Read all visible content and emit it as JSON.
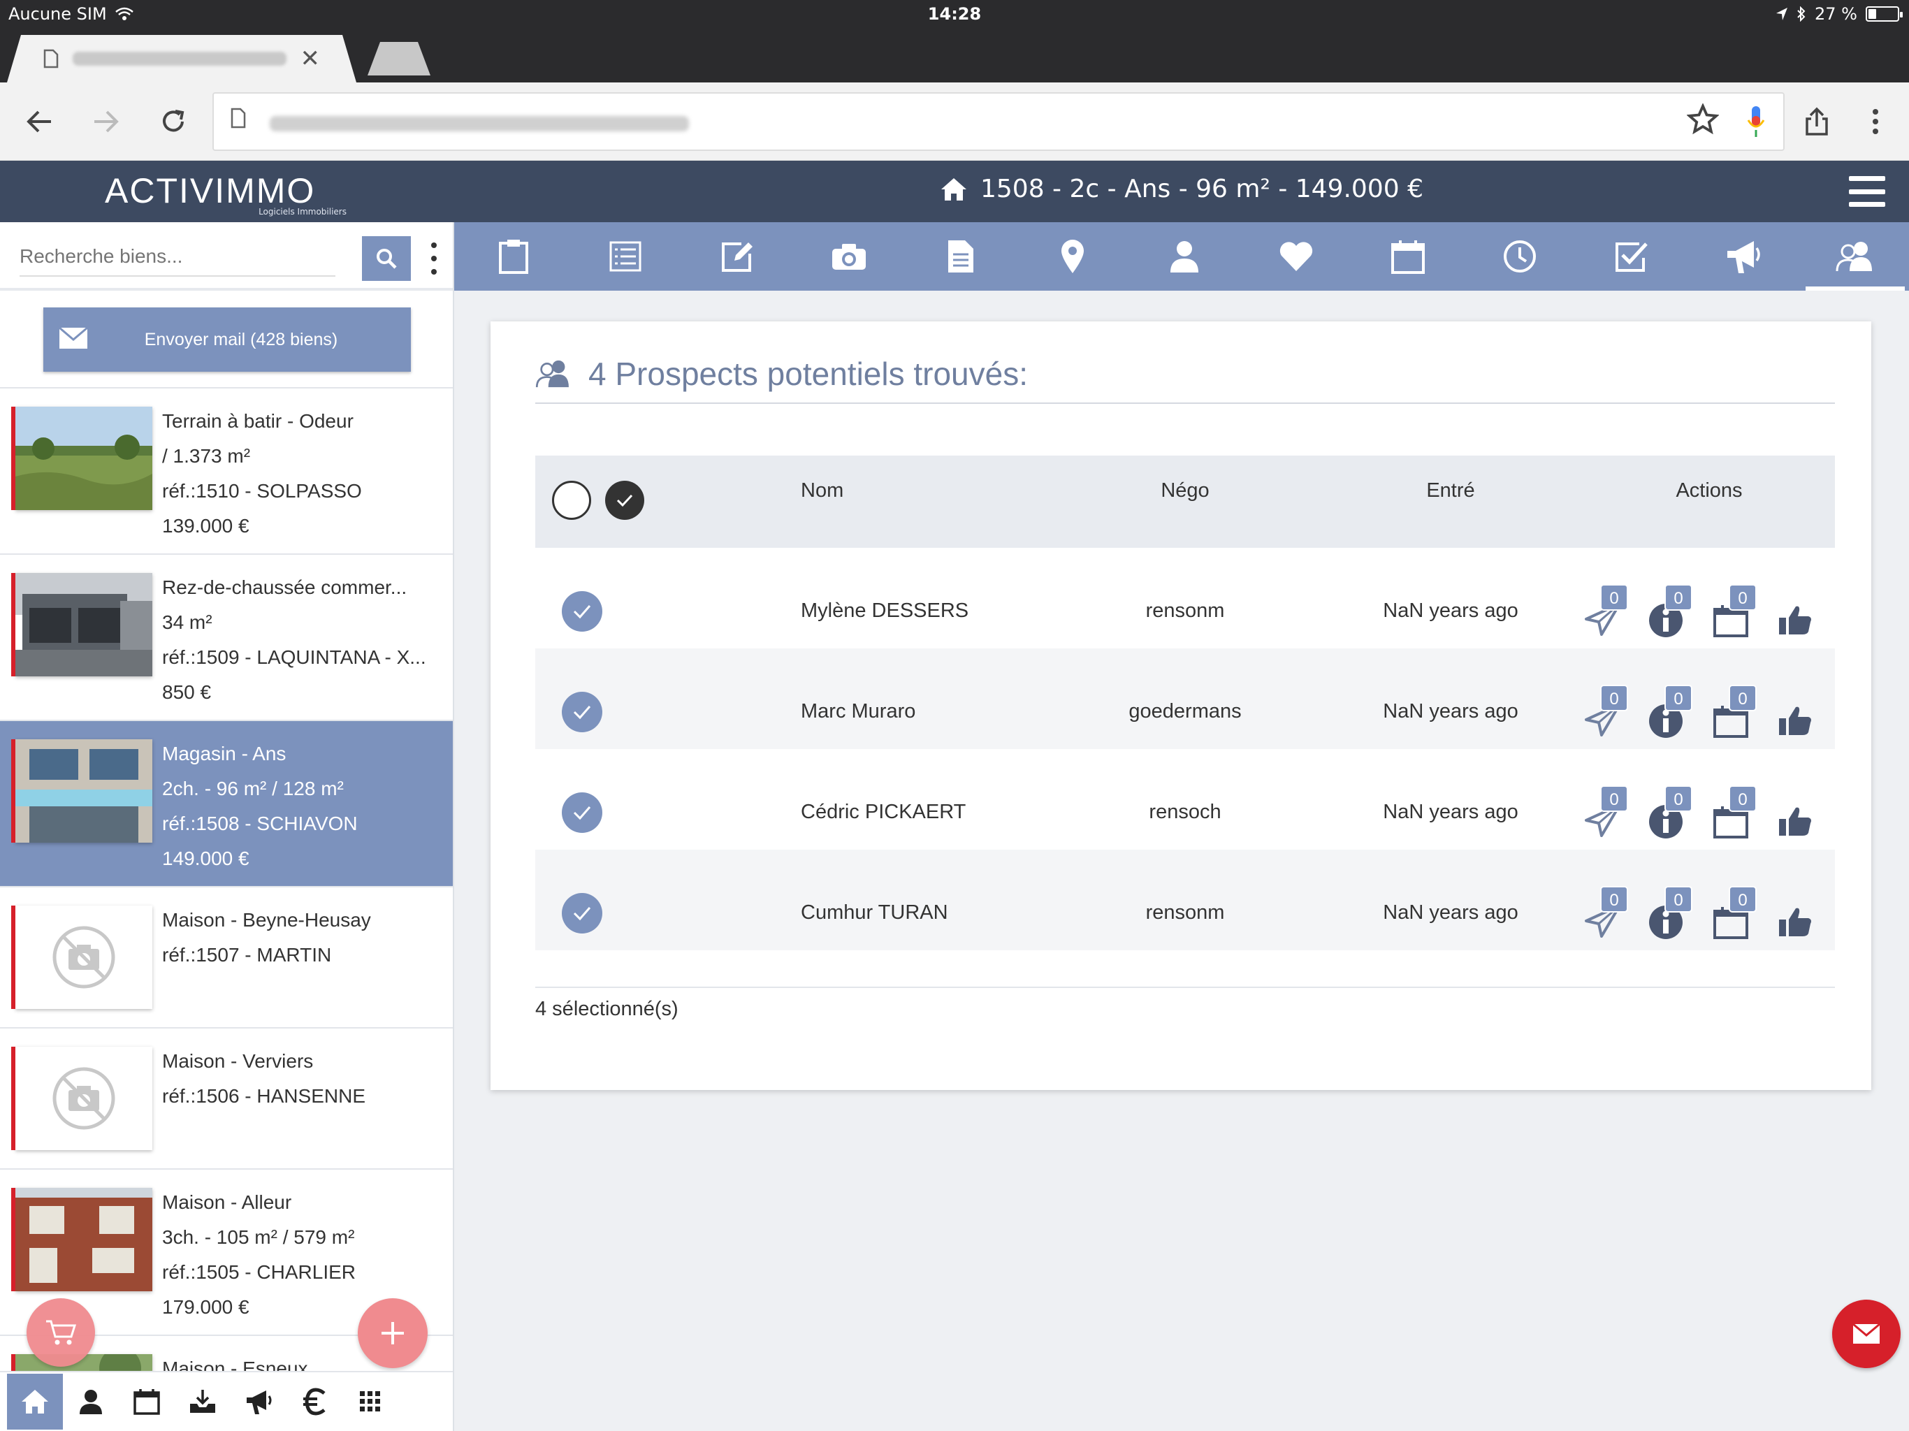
{
  "status_bar": {
    "carrier": "Aucune SIM",
    "time": "14:28",
    "battery_percent": "27 %",
    "battery_level": 0.27
  },
  "browser": {
    "icons": {
      "back": "arrow-left-icon",
      "forward": "arrow-right-icon",
      "reload": "reload-icon",
      "bookmark": "star-icon",
      "voice": "mic-icon",
      "share": "share-icon",
      "menu": "more-vertical-icon",
      "tab_close": "close-icon"
    }
  },
  "header": {
    "logo_text": "ACTIVIMMO",
    "logo_tagline": "Logiciels Immobiliers",
    "title": "1508 - 2c - Ans - 96 m² - 149.000 €"
  },
  "sidebar": {
    "search_placeholder": "Recherche biens...",
    "mail_button_label": "Envoyer mail (428 biens)",
    "properties": [
      {
        "lines": [
          "Terrain à batir - Odeur",
          "/ 1.373 m²",
          "réf.:1510 - SOLPASSO",
          "139.000 €"
        ],
        "image": "field",
        "selected": false
      },
      {
        "lines": [
          "Rez-de-chaussée commer...",
          "34 m²",
          "réf.:1509 - LAQUINTANA - X...",
          "850 €"
        ],
        "image": "storefront",
        "selected": false
      },
      {
        "lines": [
          "Magasin - Ans",
          "2ch. - 96 m² / 128 m²",
          "réf.:1508 - SCHIAVON",
          "149.000 €"
        ],
        "image": "shop",
        "selected": true
      },
      {
        "lines": [
          "Maison - Beyne-Heusay",
          "réf.:1507 - MARTIN"
        ],
        "image": "none",
        "selected": false
      },
      {
        "lines": [
          "Maison - Verviers",
          "réf.:1506 - HANSENNE"
        ],
        "image": "none",
        "selected": false
      },
      {
        "lines": [
          "Maison - Alleur",
          "3ch. - 105 m² / 579 m²",
          "réf.:1505 - CHARLIER",
          "179.000 €"
        ],
        "image": "brick",
        "selected": false
      },
      {
        "lines": [
          "Maison - Esneux"
        ],
        "image": "field",
        "selected": false
      }
    ]
  },
  "main": {
    "title": "4 Prospects potentiels trouvés:",
    "columns": {
      "nom": "Nom",
      "nego": "Négo",
      "entre": "Entré",
      "actions": "Actions"
    },
    "rows": [
      {
        "nom": "Mylène DESSERS",
        "nego": "rensonm",
        "entre": "NaN years ago",
        "badges": [
          "0",
          "0",
          "0"
        ]
      },
      {
        "nom": "Marc Muraro",
        "nego": "goedermans",
        "entre": "NaN years ago",
        "badges": [
          "0",
          "0",
          "0"
        ]
      },
      {
        "nom": "Cédric PICKAERT",
        "nego": "rensoch",
        "entre": "NaN years ago",
        "badges": [
          "0",
          "0",
          "0"
        ]
      },
      {
        "nom": "Cumhur TURAN",
        "nego": "rensonm",
        "entre": "NaN years ago",
        "badges": [
          "0",
          "0",
          "0"
        ]
      }
    ],
    "selected_count": "4 sélectionné(s)"
  },
  "colors": {
    "accent": "#7c92bd",
    "header_bg": "#3d4a61",
    "red": "#d6202a",
    "fab_pink": "#f08b8f"
  }
}
